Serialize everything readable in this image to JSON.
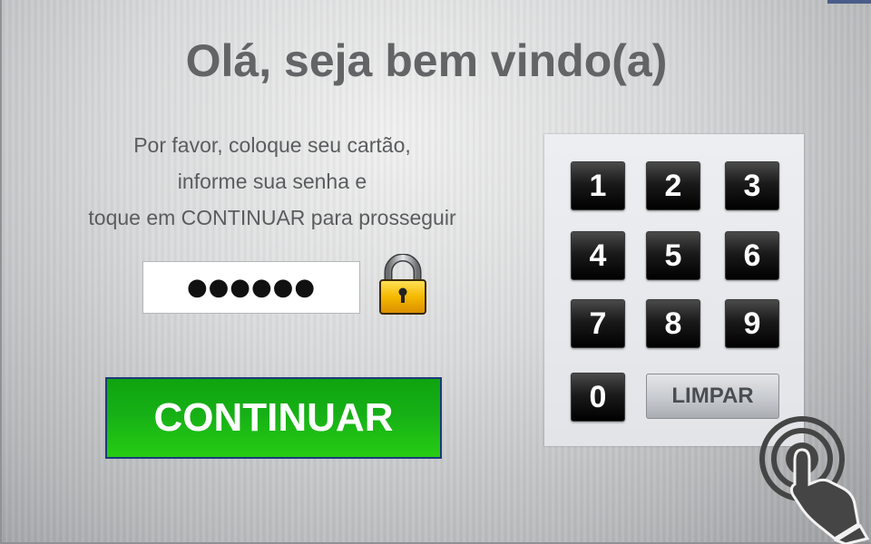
{
  "header": {
    "title": "Olá, seja bem vindo(a)"
  },
  "instructions": {
    "line1": "Por favor, coloque seu cartão,",
    "line2": "informe sua senha e",
    "line3": "toque em CONTINUAR para prosseguir"
  },
  "pin": {
    "value": "●●●●●●"
  },
  "actions": {
    "continue_label": "CONTINUAR"
  },
  "keypad": {
    "keys": [
      "1",
      "2",
      "3",
      "4",
      "5",
      "6",
      "7",
      "8",
      "9",
      "0"
    ],
    "clear_label": "LIMPAR"
  },
  "icons": {
    "lock": "lock-icon",
    "touch": "touch-hand-icon"
  },
  "colors": {
    "title_text": "#626466",
    "continue_green": "#16b016",
    "continue_border": "#1b3a7a",
    "key_black": "#000000",
    "lock_gold": "#f5b800"
  }
}
